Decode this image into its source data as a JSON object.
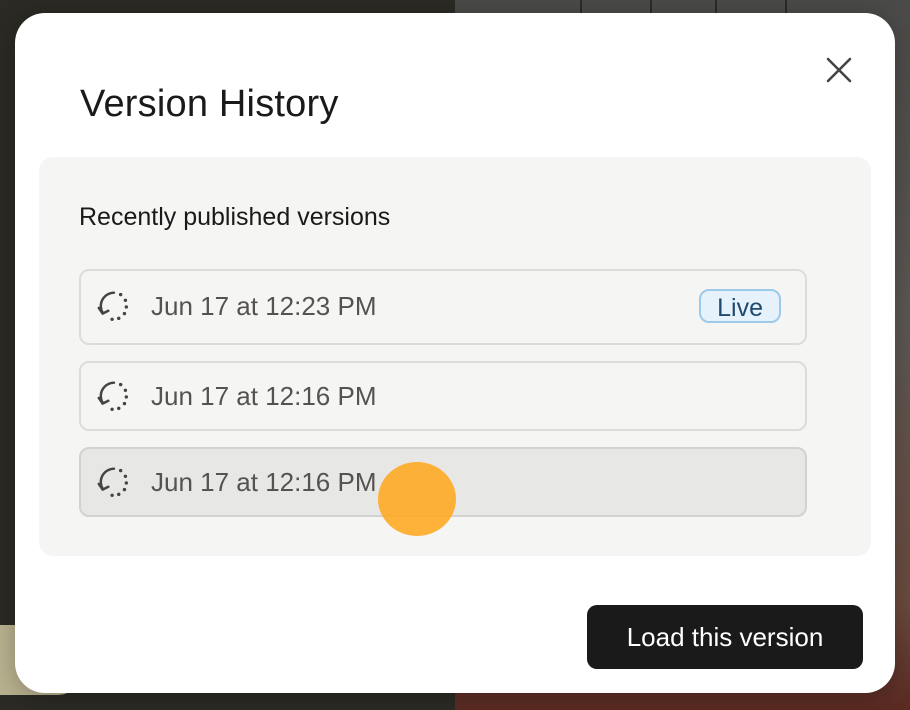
{
  "modal": {
    "title": "Version History",
    "close_icon": "close-icon"
  },
  "versions_panel": {
    "heading": "Recently published versions",
    "items": [
      {
        "label": "Jun 17 at 12:23 PM",
        "badge": "Live",
        "icon": "restore-history-icon",
        "selected": false
      },
      {
        "label": "Jun 17 at 12:16 PM",
        "badge": "",
        "icon": "restore-history-icon",
        "selected": false
      },
      {
        "label": "Jun 17 at 12:16 PM",
        "badge": "",
        "icon": "restore-history-icon",
        "selected": true
      }
    ]
  },
  "footer": {
    "load_button_label": "Load this version"
  },
  "colors": {
    "primary_button": "#1a1a1a",
    "live_badge_bg": "#e6f2fb",
    "live_badge_border": "#9ecaea",
    "live_badge_text": "#1f4a6e",
    "cursor_highlight": "#ffa920",
    "panel_bg": "#f5f5f4",
    "selected_item_bg": "#e7e7e6"
  }
}
